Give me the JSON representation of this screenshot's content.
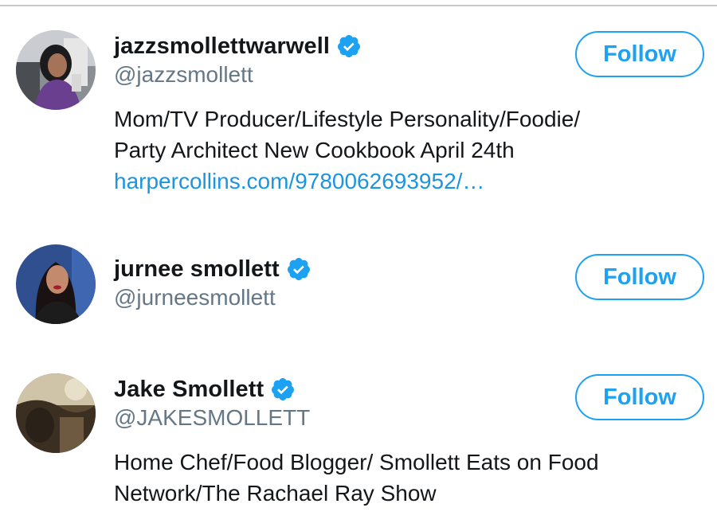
{
  "colors": {
    "accent": "#1da1f2",
    "link": "#1b95e0",
    "name_text": "#14171a",
    "handle_text": "#657786",
    "verified_badge": "#1da1f2"
  },
  "users": [
    {
      "display_name": "jazzsmollettwarwell",
      "verified": true,
      "handle": "@jazzsmollett",
      "bio_lines": [
        "Mom/TV Producer/Lifestyle Personality/Foodie/",
        "Party Architect New Cookbook April 24th"
      ],
      "bio_link": "harpercollins.com/9780062693952/…",
      "follow_label": "Follow",
      "avatar_icon": "profile-photo"
    },
    {
      "display_name": "jurnee smollett",
      "verified": true,
      "handle": "@jurneesmollett",
      "bio_lines": [],
      "follow_label": "Follow",
      "avatar_icon": "profile-photo"
    },
    {
      "display_name": "Jake Smollett",
      "verified": true,
      "handle": "@JAKESMOLLETT",
      "bio_lines": [
        "Home Chef/Food Blogger/ Smollett Eats on Food",
        "Network/The Rachael Ray Show"
      ],
      "follow_label": "Follow",
      "avatar_icon": "profile-photo"
    }
  ]
}
